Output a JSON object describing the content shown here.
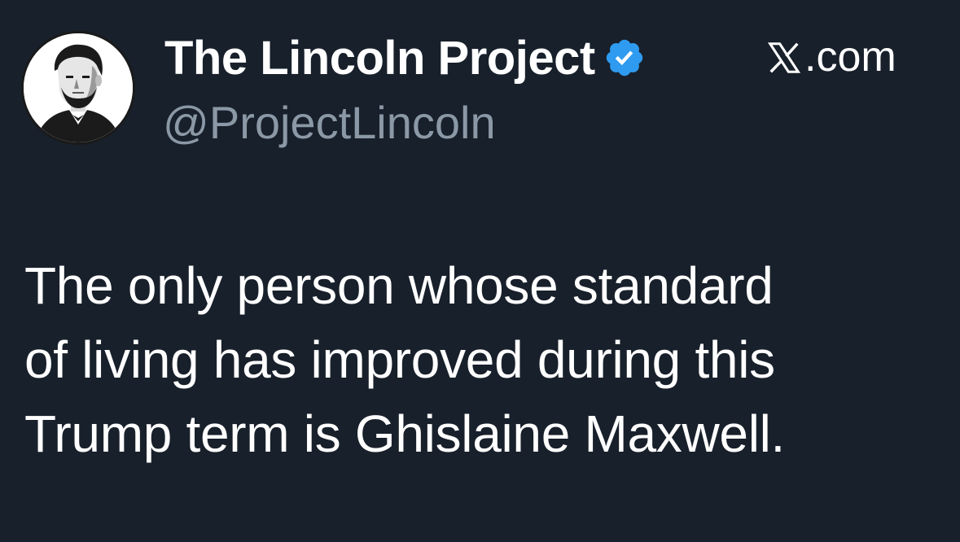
{
  "account": {
    "display_name": "The Lincoln Project",
    "handle": "@ProjectLincoln",
    "verified": true,
    "verified_color": "#2f9bf0",
    "avatar_icon": "lincoln-portrait-avatar"
  },
  "source": {
    "icon": "x-logo-icon",
    "label": ".com"
  },
  "tweet": {
    "lines": [
      "The only person whose standard",
      "of living has improved during this",
      "Trump term is Ghislaine Maxwell."
    ]
  },
  "colors": {
    "background": "#18202b",
    "primary_text": "#ffffff",
    "secondary_text": "#8b98a5"
  }
}
